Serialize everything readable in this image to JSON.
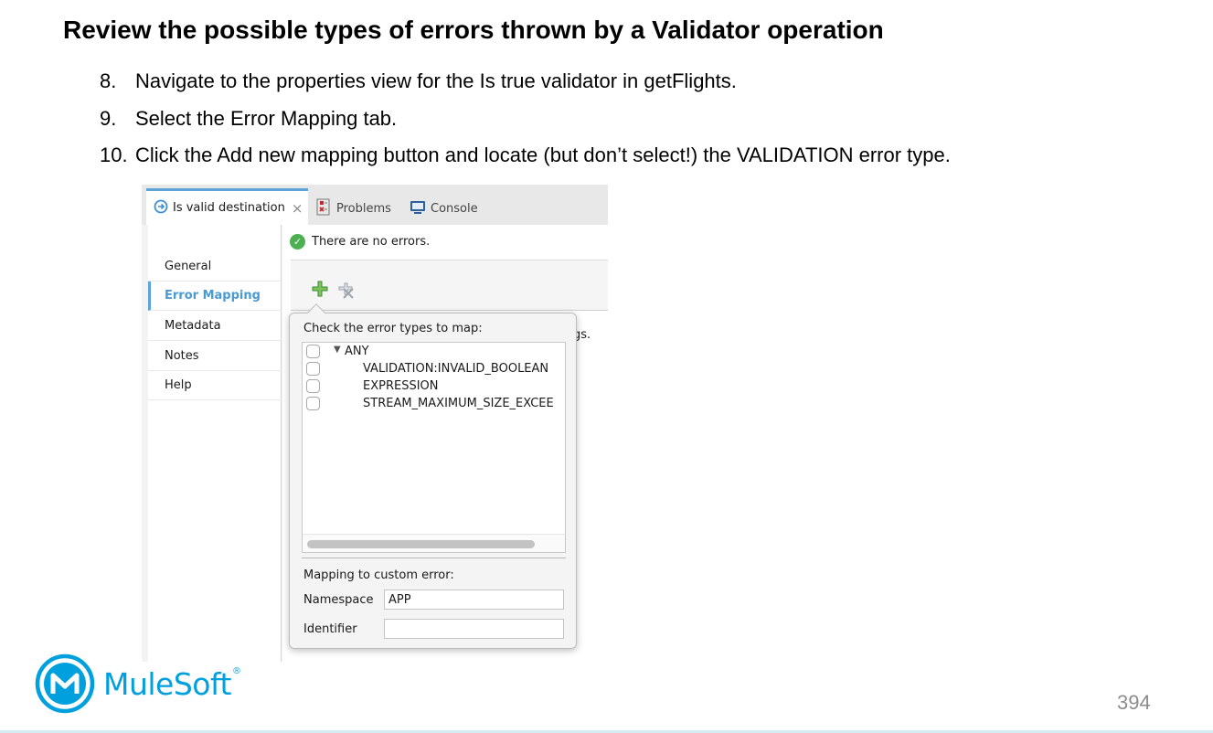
{
  "slide": {
    "title": "Review the possible types of errors thrown by a Validator operation",
    "steps": [
      {
        "number": "8.",
        "text": "Navigate to the properties view for the Is true validator in getFlights."
      },
      {
        "number": "9.",
        "text": "Select the Error Mapping tab."
      },
      {
        "number": "10.",
        "text": "Click the Add new mapping button and locate (but don’t select!) the VALIDATION error type."
      }
    ],
    "page_number": "394",
    "logo_text": "MuleSoft",
    "logo_reg": "®"
  },
  "screenshot": {
    "tabs": [
      {
        "label": "Is valid destination",
        "icon": "validator-icon",
        "close": "×"
      },
      {
        "label": "Problems",
        "icon": "problems-icon"
      },
      {
        "label": "Console",
        "icon": "console-icon"
      }
    ],
    "nav_items": [
      {
        "label": "General"
      },
      {
        "label": "Error Mapping"
      },
      {
        "label": "Metadata"
      },
      {
        "label": "Notes"
      },
      {
        "label": "Help"
      }
    ],
    "status_text": "There are no errors.",
    "add_icon": "plus-icon",
    "remove_icon": "remove-icon",
    "behind_text": "gs.",
    "popup": {
      "heading": "Check the error types to map:",
      "tree_items": [
        {
          "label": "ANY",
          "toggle": "▼",
          "checked": false
        },
        {
          "label": "VALIDATION:INVALID_BOOLEAN",
          "checked": false
        },
        {
          "label": "EXPRESSION",
          "checked": false
        },
        {
          "label": "STREAM_MAXIMUM_SIZE_EXCEE",
          "checked": false
        }
      ],
      "custom_heading": "Mapping to custom error:",
      "namespace_label": "Namespace",
      "namespace_value": "APP",
      "identifier_label": "Identifier",
      "identifier_value": ""
    }
  },
  "colors": {
    "accent_blue": "#5da4d9",
    "active_text": "#4a9ad4",
    "status_green": "#4caf50",
    "add_green": "#53a34a",
    "brand": "#00a0df",
    "page_number": "#8c8c8c"
  }
}
